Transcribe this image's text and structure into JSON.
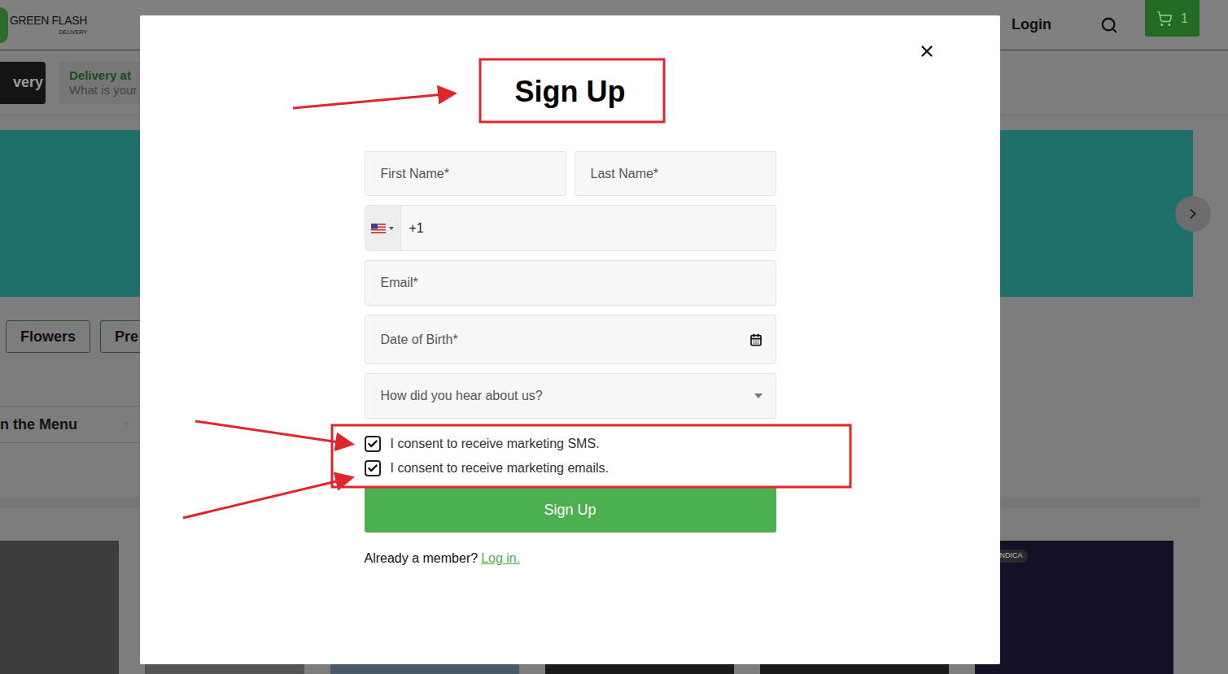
{
  "site": {
    "logo": {
      "name": "GREEN FLASH",
      "tagline": "DELIVERY"
    },
    "login": "Login",
    "cart_count": "1",
    "delivery_button": "very",
    "delivery": {
      "label": "Delivery at",
      "prompt": "What is your"
    },
    "categories": [
      "Flowers",
      "Pre"
    ],
    "menu_dropdown": "n the Menu",
    "product_badge": "INDICA"
  },
  "modal": {
    "title": "Sign Up",
    "name_fields": [
      {
        "placeholder": "First Name*"
      },
      {
        "placeholder": "Last Name*"
      }
    ],
    "phone": {
      "country_code": "+1"
    },
    "email": {
      "placeholder": "Email*"
    },
    "dob": {
      "placeholder": "Date of Birth*"
    },
    "referral": {
      "placeholder": "How did you hear about us?"
    },
    "consents": [
      {
        "label": "I consent to receive marketing SMS.",
        "checked": true
      },
      {
        "label": "I consent to receive marketing emails.",
        "checked": true
      }
    ],
    "submit": "Sign Up",
    "footer": {
      "text": "Already a member?",
      "link": "Log in."
    }
  }
}
